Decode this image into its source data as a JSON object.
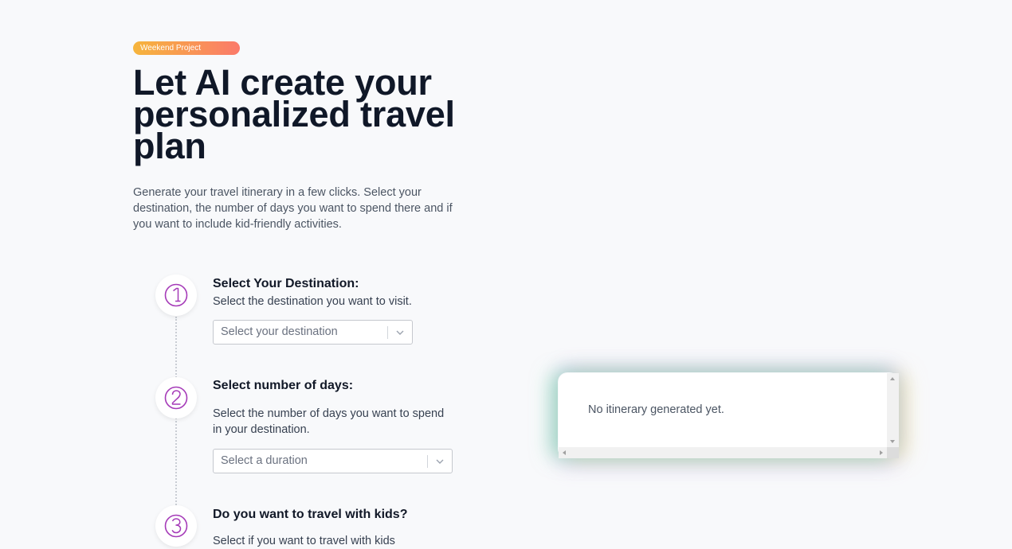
{
  "badge": {
    "label": "Weekend Project"
  },
  "hero": {
    "title": "Let AI create your personalized travel plan",
    "description": "Generate your travel itinerary in a few clicks. Select your destination, the number of days you want to spend there and if you want to include kid-friendly activities."
  },
  "steps": [
    {
      "number": "1",
      "title": "Select Your Destination:",
      "description": "Select the destination you want to visit.",
      "select_placeholder": "Select your destination"
    },
    {
      "number": "2",
      "title": "Select number of days:",
      "description": "Select the number of days you want to spend in your destination.",
      "select_placeholder": "Select a duration"
    },
    {
      "number": "3",
      "title": "Do you want to travel with kids?",
      "description": "Select if you want to travel with kids"
    }
  ],
  "itinerary_panel": {
    "empty_message": "No itinerary generated yet."
  },
  "colors": {
    "accent": "#a53ab8",
    "badge_start": "#f6b53c",
    "badge_end": "#fb7a6a",
    "title": "#101828"
  },
  "icons": {
    "step_1": "circled-number-1-icon",
    "step_2": "circled-number-2-icon",
    "step_3": "circled-number-3-icon",
    "dropdown": "chevron-down-icon"
  }
}
